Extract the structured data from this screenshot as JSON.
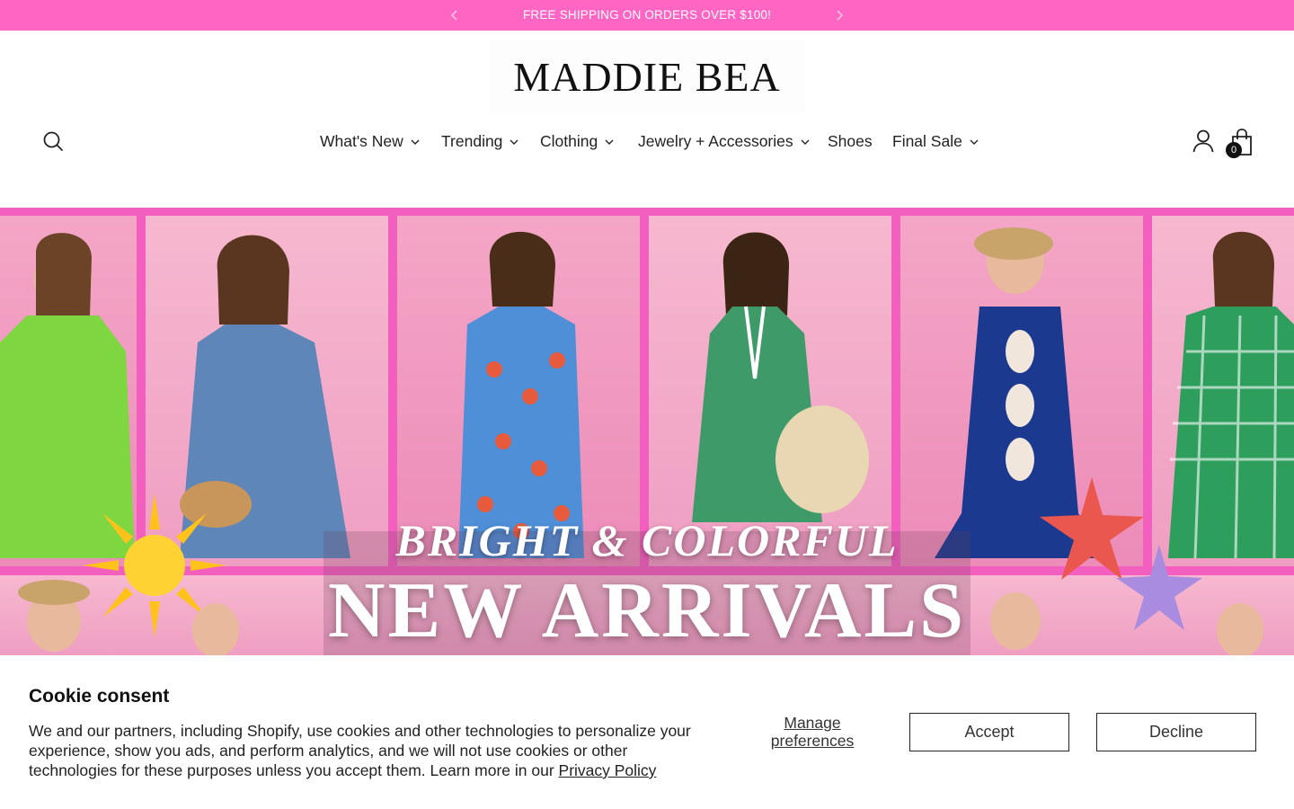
{
  "announcement": {
    "text": "FREE SHIPPING ON ORDERS OVER $100!",
    "background": "#ff66c4"
  },
  "brand": {
    "logo_text": "MADDIE BEA"
  },
  "nav": {
    "items": [
      {
        "label": "What's New",
        "has_dropdown": true
      },
      {
        "label": "Trending",
        "has_dropdown": true
      },
      {
        "label": "Clothing",
        "has_dropdown": true
      },
      {
        "label": "Jewelry + Accessories",
        "has_dropdown": true
      },
      {
        "label": "Shoes",
        "has_dropdown": false
      },
      {
        "label": "Final Sale",
        "has_dropdown": true
      }
    ]
  },
  "header_icons": {
    "search": "search-icon",
    "account": "account-icon",
    "cart": "shopping-bag-icon",
    "cart_count": "0"
  },
  "hero": {
    "subtitle": "BRIGHT & COLORFUL",
    "title": "NEW ARRIVALS",
    "accent": "#f25fbf"
  },
  "cookie": {
    "title": "Cookie consent",
    "body": "We and our partners, including Shopify, use cookies and other technologies to personalize your experience, show you ads, and perform analytics, and we will not use cookies or other technologies for these purposes unless you accept them. Learn more in our ",
    "privacy_link": "Privacy Policy",
    "manage_label": "Manage preferences",
    "accept_label": "Accept",
    "decline_label": "Decline"
  }
}
